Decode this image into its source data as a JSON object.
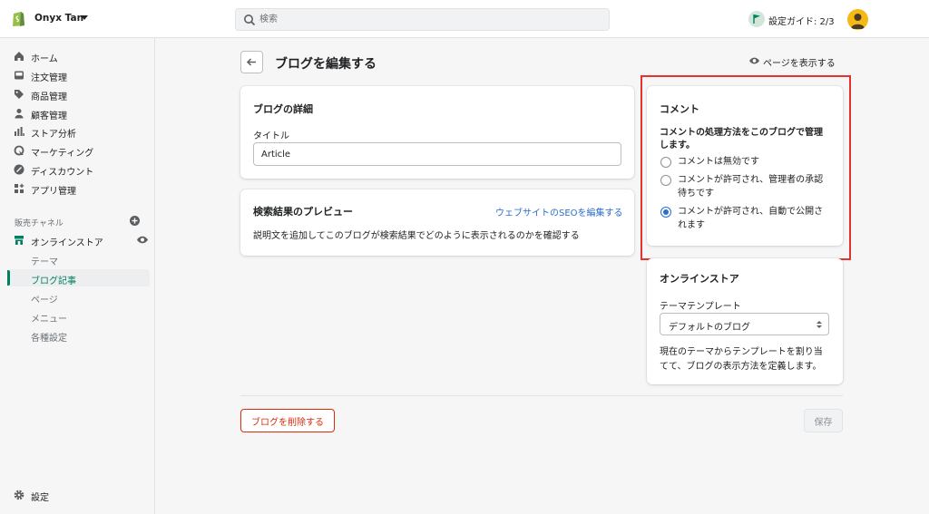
{
  "topbar": {
    "store_name": "Onyx Tan",
    "search_placeholder": "検索",
    "setup_guide": "設定ガイド: 2/3"
  },
  "sidebar": {
    "main_items": [
      {
        "label": "ホーム",
        "icon": "home-icon"
      },
      {
        "label": "注文管理",
        "icon": "orders-icon"
      },
      {
        "label": "商品管理",
        "icon": "tag-icon"
      },
      {
        "label": "顧客管理",
        "icon": "person-icon"
      },
      {
        "label": "ストア分析",
        "icon": "analytics-icon"
      },
      {
        "label": "マーケティング",
        "icon": "marketing-icon"
      },
      {
        "label": "ディスカウント",
        "icon": "discount-icon"
      },
      {
        "label": "アプリ管理",
        "icon": "apps-icon"
      }
    ],
    "channels_heading": "販売チャネル",
    "online_store": "オンラインストア",
    "sub_items": [
      "テーマ",
      "ブログ記事",
      "ページ",
      "メニュー",
      "各種設定"
    ],
    "active_sub_item": "ブログ記事",
    "settings": "設定"
  },
  "page": {
    "title": "ブログを編集する",
    "view_page": "ページを表示する"
  },
  "blog_details": {
    "title": "ブログの詳細",
    "title_label": "タイトル",
    "title_value": "Article"
  },
  "seo": {
    "title": "検索結果のプレビュー",
    "edit_link": "ウェブサイトのSEOを編集する",
    "description": "説明文を追加してこのブログが検索結果でどのように表示されるのかを確認する"
  },
  "comments": {
    "title": "コメント",
    "subtitle_line1": "コメントの処理方法をこのブログで管理",
    "subtitle_line2": "します。",
    "options": [
      {
        "line1": "コメントは無効です",
        "line2": "",
        "checked": false
      },
      {
        "line1": "コメントが許可され、管理者の承認",
        "line2": "待ちです",
        "checked": false
      },
      {
        "line1": "コメントが許可され、自動で公開さ",
        "line2": "れます",
        "checked": true
      }
    ]
  },
  "online_store_card": {
    "title": "オンラインストア",
    "template_label": "テーマテンプレート",
    "template_value": "デフォルトのブログ",
    "help_line1": "現在のテーマからテンプレートを割り当",
    "help_line2": "てて、ブログの表示方法を定義します。"
  },
  "footer": {
    "delete": "ブログを削除する",
    "save": "保存"
  },
  "colors": {
    "brand_green": "#008060",
    "highlight_red": "#e5312f",
    "link_blue": "#2c6ecb",
    "delete_red": "#d82c0d"
  }
}
